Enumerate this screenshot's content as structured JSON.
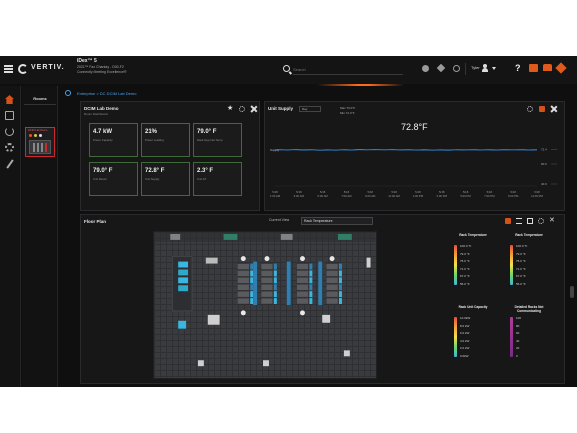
{
  "topbar": {
    "logo": "VERTIV.",
    "app_title": "iDex™ 5",
    "app_sub1": "2021™ Fax Chantay - D00-F2",
    "app_sub2": "Connectly Meeting Excellence®",
    "search_placeholder": "Search",
    "user": "Tyler",
    "help": "?"
  },
  "rooms": {
    "title": "Rooms",
    "card_label": "DCIM Lab Demo"
  },
  "breadcrumb": "Enterprise  >  DC  DCIM Lab Demo",
  "dcim_panel": {
    "title": "DCIM Lab Demo",
    "subtitle": "Room Dashboard",
    "tiles": [
      {
        "value": "4.7 kW",
        "label": "Power Capacity"
      },
      {
        "value": "21%",
        "label": "Power Loading"
      },
      {
        "value": "79.0° F",
        "label": "Rack Avg Inlet Temp"
      },
      {
        "value": "79.0° F",
        "label": "Unit Return"
      },
      {
        "value": "72.8° F",
        "label": "Unit Supply"
      },
      {
        "value": "2.3° F",
        "label": "Unit ΔT"
      }
    ]
  },
  "unit_supply": {
    "title": "Unit Supply",
    "range": "Day",
    "legend_max": "Max  79.0°F",
    "legend_min": "Min  72.4°F",
    "current": "72.8°F",
    "series_label": "Supply"
  },
  "chart_data": {
    "type": "line",
    "title": "Unit Supply",
    "x": [
      "1:00 AM",
      "3:00 AM",
      "5:00 AM",
      "7:00 AM",
      "9:00 AM",
      "11:00 AM",
      "1:00 PM",
      "3:00 PM",
      "5:00 PM",
      "7:00 PM",
      "9:00 PM",
      "11:00 PM"
    ],
    "x_dates": [
      "5/18",
      "5/18",
      "5/18",
      "5/18",
      "5/18",
      "5/18",
      "5/18",
      "5/18",
      "5/18",
      "5/18",
      "5/18",
      "5/18"
    ],
    "series": [
      {
        "name": "Supply",
        "values": [
          72.8,
          72.9,
          72.7,
          72.8,
          73.0,
          72.9,
          72.8,
          72.7,
          72.9,
          72.8,
          72.9,
          72.8
        ]
      }
    ],
    "y_ticks": [
      "72.4",
      "60.0",
      "40.0"
    ],
    "ylim": [
      40,
      80
    ],
    "grid": false,
    "line_color": "#3aa0ff"
  },
  "floorplan": {
    "title": "Floor Plan",
    "current_view_label": "Current View",
    "view_value": "Rack  Temperature"
  },
  "legends": [
    {
      "title": "Rack\nTemperature",
      "gradient": "linear-gradient(#e84c3d,#f2a03a,#f5e04a,#6fd66a,#3ab7e0)",
      "ticks": [
        "100.0 °F",
        "79.0 °F",
        "75.0 °F",
        "71.0 °F",
        "67.0 °F",
        "55.0 °F"
      ]
    },
    {
      "title": "Rack\nTemperature",
      "gradient": "linear-gradient(#e84c3d,#f2a03a,#f5e04a,#6fd66a,#3ab7e0)",
      "ticks": [
        "100.0 °F",
        "79.0 °F",
        "75.0 °F",
        "71.0 °F",
        "67.0 °F",
        "55.0 °F"
      ]
    },
    {
      "title": "Rack\nUnit Capacity",
      "gradient": "linear-gradient(#e84c3d,#f2a03a,#f5e04a,#6fd66a,#3ab7e0)",
      "ticks": [
        "10.0kW",
        "8.0 kW",
        "6.0 kW",
        "4.0 kW",
        "2.0 kW",
        "0.0kW"
      ]
    },
    {
      "title": "Detailed\nRacks Not\nCommunicating",
      "gradient": "linear-gradient(#b03b9a,#7a2a88)",
      "ticks": [
        "100",
        "80",
        "60",
        "40",
        "20",
        "0"
      ]
    }
  ],
  "colors": {
    "accent": "#d2521a",
    "link": "#4aa3e8",
    "tile_border": "#3f6b3a"
  }
}
